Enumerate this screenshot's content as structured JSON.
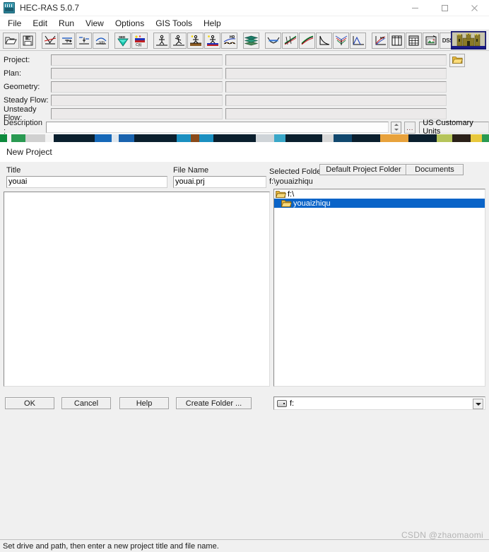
{
  "window": {
    "title": "HEC-RAS 5.0.7",
    "app_icon": "hec-ras-icon",
    "controls": {
      "minimize": "minimize-icon",
      "maximize": "maximize-icon",
      "close": "close-icon"
    }
  },
  "menu": {
    "items": [
      {
        "label": "File"
      },
      {
        "label": "Edit"
      },
      {
        "label": "Run"
      },
      {
        "label": "View"
      },
      {
        "label": "Options"
      },
      {
        "label": "GIS Tools"
      },
      {
        "label": "Help"
      }
    ]
  },
  "toolbar": {
    "buttons": [
      {
        "icon": "open-folder-icon",
        "group": 1
      },
      {
        "icon": "save-disk-icon",
        "group": 1
      },
      {
        "icon": "geometric-data-icon",
        "group": 2
      },
      {
        "icon": "steady-flow-data-icon",
        "group": 2
      },
      {
        "icon": "unsteady-flow-data-icon",
        "group": 2
      },
      {
        "icon": "quasi-unsteady-flow-icon",
        "group": 2
      },
      {
        "icon": "sediment-data-icon",
        "group": 3
      },
      {
        "icon": "water-quality-data-icon",
        "group": 3
      },
      {
        "icon": "steady-flow-analysis-icon",
        "group": 4
      },
      {
        "icon": "unsteady-flow-analysis-icon",
        "group": 4
      },
      {
        "icon": "sediment-transport-analysis-icon",
        "group": 4
      },
      {
        "icon": "water-quality-analysis-icon",
        "group": 4
      },
      {
        "icon": "hydraulic-design-icon",
        "group": 4
      },
      {
        "icon": "ras-mapper-icon",
        "group": 5
      },
      {
        "icon": "cross-section-plot-icon",
        "group": 6
      },
      {
        "icon": "profile-plot-icon",
        "group": 6
      },
      {
        "icon": "general-profile-plot-icon",
        "group": 6
      },
      {
        "icon": "rating-curve-icon",
        "group": 6
      },
      {
        "icon": "xyz-perspective-plot-icon",
        "group": 6
      },
      {
        "icon": "hydrograph-plot-icon",
        "group": 6
      },
      {
        "icon": "detailed-output-table-icon",
        "group": 7
      },
      {
        "icon": "profile-summary-table-icon",
        "group": 7
      },
      {
        "icon": "summary-errors-table-icon",
        "group": 7
      },
      {
        "icon": "view-picture-icon",
        "group": 7
      },
      {
        "icon": "dss-button",
        "label": "DSS",
        "group": 7
      }
    ],
    "logo": "usace-castle-logo"
  },
  "project_form": {
    "fields": [
      {
        "label": "Project:",
        "value": ""
      },
      {
        "label": "Plan:",
        "value": ""
      },
      {
        "label": "Geometry:",
        "value": ""
      },
      {
        "label": "Steady Flow:",
        "value": ""
      },
      {
        "label": "Unsteady Flow:",
        "value": ""
      }
    ],
    "description_label": "Description :",
    "description_value": "",
    "units": "US Customary Units",
    "folder_button_icon": "open-folder-icon",
    "spinner_icon": "spinner-updown-icon",
    "ellipsis_button": "..."
  },
  "dialog": {
    "title": "New Project",
    "title_field": {
      "label": "Title",
      "value": "youai"
    },
    "filename_field": {
      "label": "File Name",
      "value": "youai.prj"
    },
    "selected_folder": {
      "label": "Selected Folder",
      "path": "f:\\youaizhiqu"
    },
    "folder_buttons": [
      {
        "label": "Default Project Folder"
      },
      {
        "label": "Documents"
      }
    ],
    "folder_tree": [
      {
        "label": "f:\\",
        "indent": 1,
        "selected": false,
        "icon": "folder-open-icon"
      },
      {
        "label": "youaizhiqu",
        "indent": 2,
        "selected": true,
        "icon": "folder-icon"
      }
    ],
    "drive_selector": {
      "value": "f:",
      "icon": "drive-icon",
      "arrow_icon": "chevron-down-icon"
    },
    "buttons": [
      {
        "label": "OK",
        "name": "ok-button"
      },
      {
        "label": "Cancel",
        "name": "cancel-button"
      },
      {
        "label": "Help",
        "name": "help-button"
      },
      {
        "label": "Create Folder ...",
        "name": "create-folder-button"
      }
    ],
    "status_text": "Set drive and path, then enter a new project title and file name."
  },
  "watermark": "CSDN @zhaomaomi",
  "colors": {
    "selection_blue": "#0a64c8",
    "dialog_face": "#f0f0f0",
    "folder_yellow": "#f5c542"
  }
}
